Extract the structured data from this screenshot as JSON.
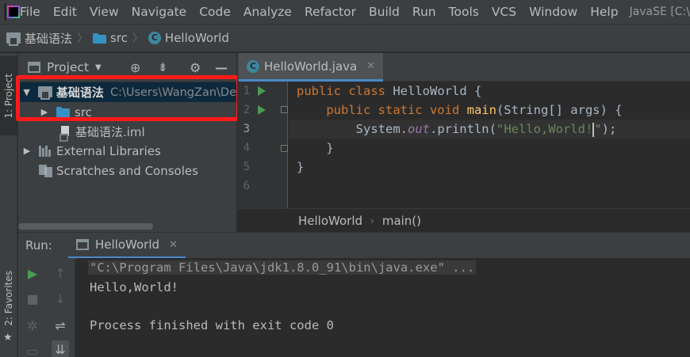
{
  "menubar": {
    "items": [
      "File",
      "Edit",
      "View",
      "Navigate",
      "Code",
      "Analyze",
      "Refactor",
      "Build",
      "Run",
      "Tools",
      "VCS",
      "Window",
      "Help"
    ],
    "window_title": "JavaSE [C:\\"
  },
  "navbar": {
    "crumbs": [
      "基础语法",
      "src",
      "HelloWorld"
    ]
  },
  "left_strip": {
    "project_tab": "1: Project",
    "favorites_tab": "2: Favorites"
  },
  "project_panel": {
    "title": "Project",
    "tree": [
      {
        "label": "基础语法",
        "hint": "C:\\Users\\WangZan\\De"
      },
      {
        "label": "src"
      },
      {
        "label": "基础语法.iml"
      },
      {
        "label": "External Libraries"
      },
      {
        "label": "Scratches and Consoles"
      }
    ]
  },
  "editor": {
    "tab_label": "HelloWorld.java",
    "line_numbers": [
      "1",
      "2",
      "3",
      "4",
      "5",
      "6"
    ],
    "code": {
      "l1_kw": "public class ",
      "l1_rest": "HelloWorld {",
      "l2_indent": "    ",
      "l2_kw": "public static void ",
      "l2_fn": "main",
      "l2_rest": "(String[] args) {",
      "l3_indent": "        ",
      "l3_a": "System.",
      "l3_field": "out",
      "l3_b": ".println(",
      "l3_str": "\"Hello,World!",
      "l3_str_end": "\"",
      "l3_end": ");",
      "l4": "    }",
      "l5": "}"
    },
    "breadcrumbs": [
      "HelloWorld",
      "main()"
    ]
  },
  "run_panel": {
    "label": "Run:",
    "tab_label": "HelloWorld",
    "console": {
      "command": "\"C:\\Program Files\\Java\\jdk1.8.0_91\\bin\\java.exe\" ...",
      "output": "Hello,World!",
      "exit": "Process finished with exit code 0"
    }
  },
  "colors": {
    "background": "#2b2b2b",
    "panel": "#3c3f41",
    "keyword": "#cc7832",
    "string": "#6a8759",
    "highlight_box": "#ff1a1a"
  }
}
